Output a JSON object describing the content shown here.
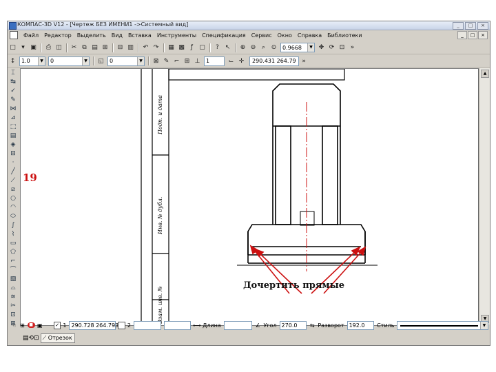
{
  "app": {
    "title": "КОМПАС-3D V12 - [Чертеж БЕЗ ИМЕНИ1 ->Системный вид]",
    "window_buttons": [
      "_",
      "□",
      "×"
    ]
  },
  "menu": [
    "Файл",
    "Редактор",
    "Выделить",
    "Вид",
    "Вставка",
    "Инструменты",
    "Спецификация",
    "Сервис",
    "Окно",
    "Справка",
    "Библиотеки"
  ],
  "toolbar1": {
    "zoom": "0.9668"
  },
  "toolbar2": {
    "layer": "1.0",
    "style": "0",
    "step": "1",
    "cursor_coords": "290.431  264.79"
  },
  "canvas": {
    "slide_number": "19",
    "stamp_labels": [
      "Подп. и дата",
      "Инв. № дубл.",
      "Взам. инв. №"
    ],
    "annotation": "Дочертить прямые",
    "arrow_color": "#cc1111"
  },
  "properties": {
    "point1_label": "1",
    "point1_value": "290.728 264.793",
    "point2_label": "2",
    "length_label": "Длина",
    "angle_label": "Угол",
    "angle_value": "270.0",
    "hatch_label": "Разворот",
    "hatch_value": "192.0",
    "style_label": "Стиль"
  },
  "tabs": {
    "segment_tab": "Отрезок"
  }
}
